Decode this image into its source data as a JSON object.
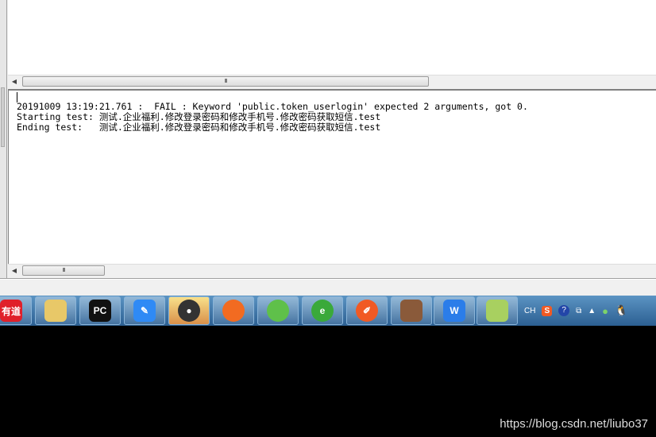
{
  "log": {
    "lines": [
      "20191009 13:19:21.761 :  FAIL : Keyword 'public.token_userlogin' expected 2 arguments, got 0.",
      "Starting test: 测试.企业福利.修改登录密码和修改手机号.修改密码获取短信.test",
      "Ending test:   测试.企业福利.修改登录密码和修改手机号.修改密码获取短信.test"
    ]
  },
  "scrollbar": {
    "grip": "III"
  },
  "taskbar": {
    "apps": [
      {
        "name": "youdao",
        "label": "有道",
        "color": "#e0202a"
      },
      {
        "name": "file-explorer",
        "label": "",
        "color": "#e8c868"
      },
      {
        "name": "pycharm",
        "label": "PC",
        "color": "#111111"
      },
      {
        "name": "notes",
        "label": "✎",
        "color": "#2f8af5"
      },
      {
        "name": "app-disc",
        "label": "●",
        "color": "#333333"
      },
      {
        "name": "firefox",
        "label": "",
        "color": "#f26b21"
      },
      {
        "name": "wechat",
        "label": "",
        "color": "#5fc04a"
      },
      {
        "name": "ie-browser",
        "label": "e",
        "color": "#3aa93a"
      },
      {
        "name": "postman",
        "label": "✐",
        "color": "#f15a24"
      },
      {
        "name": "game-character",
        "label": "",
        "color": "#8a5a3a"
      },
      {
        "name": "wps",
        "label": "W",
        "color": "#2b7de9"
      },
      {
        "name": "notepad-plus-plus",
        "label": "",
        "color": "#a8d060"
      }
    ],
    "tray": {
      "lang": "CH",
      "ime": "S",
      "help": "?"
    }
  },
  "watermark": "https://blog.csdn.net/liubo37"
}
